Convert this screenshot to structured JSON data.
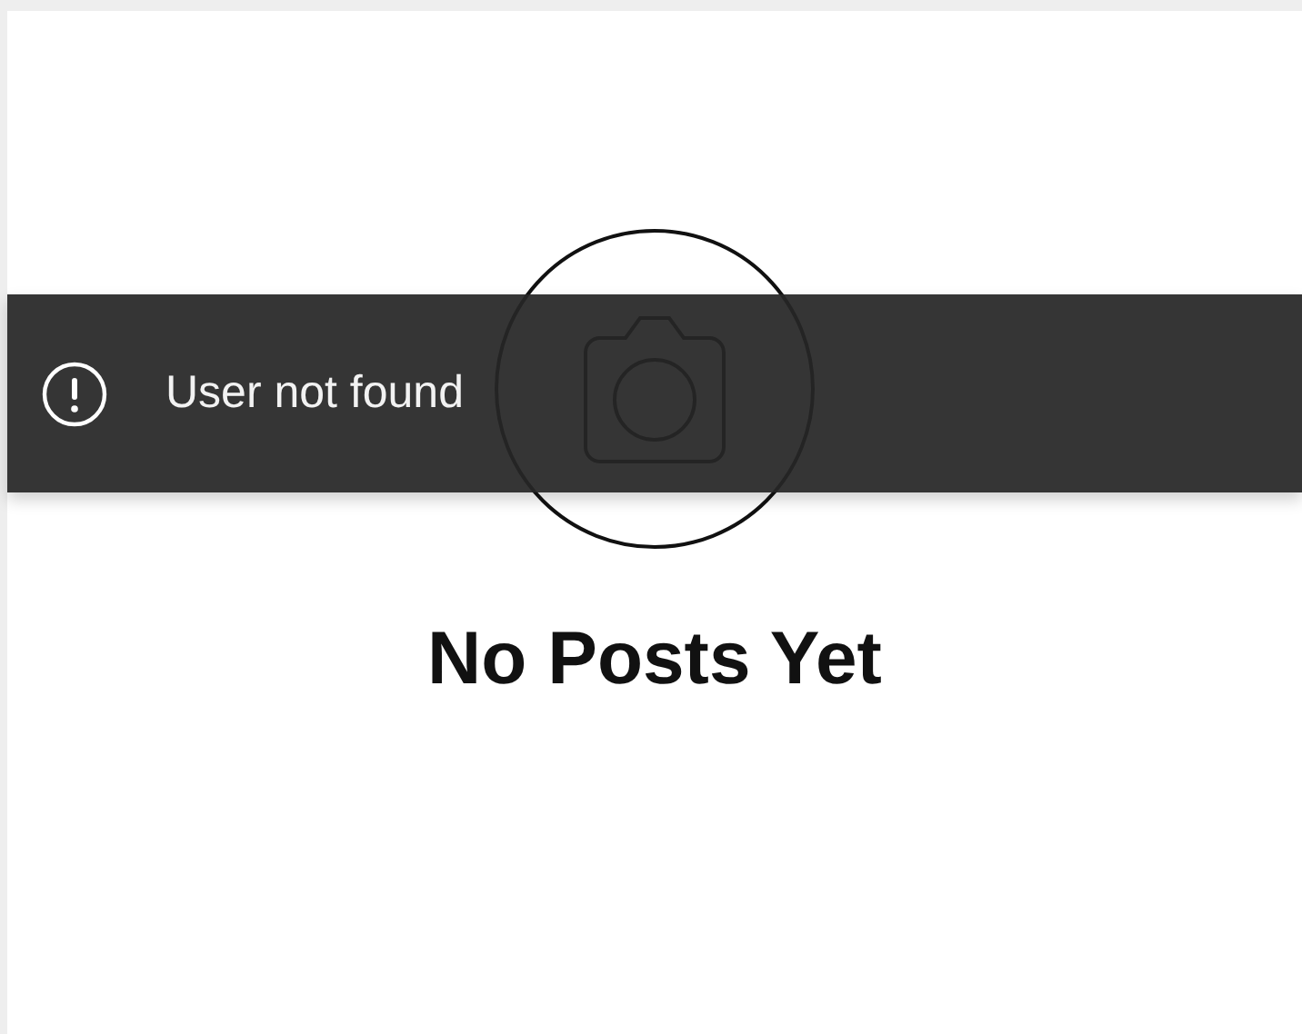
{
  "toast": {
    "kind": "error",
    "message": "User not found"
  },
  "empty_state": {
    "title": "No Posts Yet"
  }
}
